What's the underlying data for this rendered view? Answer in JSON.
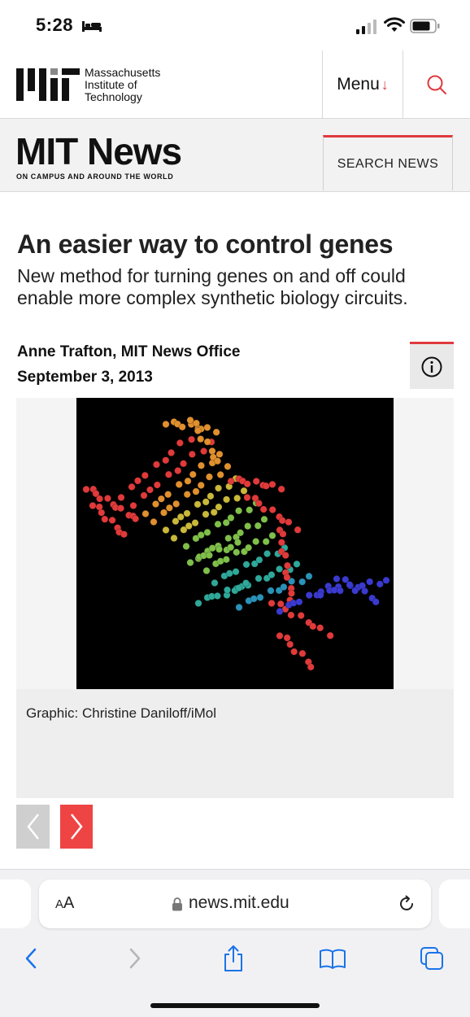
{
  "status_bar": {
    "time": "5:28",
    "icons": [
      "bed-icon",
      "signal-icon",
      "wifi-icon",
      "battery-icon"
    ]
  },
  "header": {
    "logo_icon": "mit-logo",
    "wordmark_lines": [
      "Massachusetts",
      "Institute of",
      "Technology"
    ],
    "menu_label": "Menu",
    "menu_arrow": "↓",
    "search_icon": "search-icon"
  },
  "news_bar": {
    "title": "MIT News",
    "tagline": "ON CAMPUS AND AROUND THE WORLD",
    "search_button_label": "SEARCH NEWS"
  },
  "article": {
    "title": "An easier way to control genes",
    "subtitle": "New method for turning genes on and off could enable more complex synthetic biology circuits.",
    "author": "Anne Trafton, MIT News Office",
    "date": "September 3, 2013",
    "info_icon": "info-icon",
    "image_alt": "dna-molecule-image",
    "caption": "Graphic: Christine Daniloff/iMol",
    "prev_icon": "chevron-left-icon",
    "next_icon": "chevron-right-icon"
  },
  "browser": {
    "aa_label_small": "A",
    "aa_label_large": "A",
    "url": "news.mit.edu",
    "toolbar_icons": [
      "back-icon",
      "forward-icon",
      "share-icon",
      "bookmarks-icon",
      "tabs-icon"
    ]
  },
  "colors": {
    "accent_red": "#e03a3e",
    "next_button_red": "#ef4444",
    "ios_blue": "#1a73e8"
  }
}
